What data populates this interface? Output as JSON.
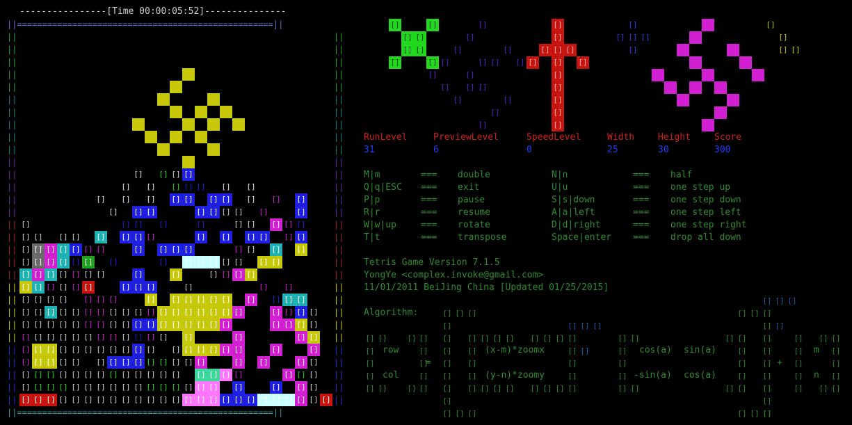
{
  "timer": {
    "text": "----------------[Time 00:00:05:52]---------------"
  },
  "board": {
    "width": 25,
    "height": 30
  },
  "stats": {
    "labels": [
      "RunLevel",
      "PreviewLevel",
      "SpeedLevel",
      "Width",
      "Height",
      "Score"
    ],
    "values": [
      "31",
      "6",
      "0",
      "25",
      "30",
      "300"
    ],
    "label_color": "#d0201a",
    "value_color": "#1e3cff"
  },
  "keys": [
    {
      "key": "M|m",
      "sep": "===",
      "action": "double",
      "key2": "N|n",
      "sep2": "===",
      "action2": "half"
    },
    {
      "key": "Q|q|ESC",
      "sep": "===",
      "action": "exit",
      "key2": "U|u",
      "sep2": "===",
      "action2": "one step up"
    },
    {
      "key": "P|p",
      "sep": "===",
      "action": "pause",
      "key2": "S|s|down",
      "sep2": "===",
      "action2": "one step down"
    },
    {
      "key": "R|r",
      "sep": "===",
      "action": "resume",
      "key2": "A|a|left",
      "sep2": "===",
      "action2": "one step left"
    },
    {
      "key": "W|w|up",
      "sep": "===",
      "action": "rotate",
      "key2": "D|d|right",
      "sep2": "===",
      "action2": "one step right"
    },
    {
      "key": "T|t",
      "sep": "===",
      "action": "transpose",
      "key2": "Space|enter",
      "sep2": "===",
      "action2": "drop all down"
    }
  ],
  "info": {
    "line1": "Tetris Game  Version 7.1.5",
    "line2": "YongYe <complex.invoke@gmail.com>",
    "line3": "11/01/2011 BeiJing China [Updated 01/25/2015]"
  },
  "algorithm": {
    "label": "Algorithm:",
    "row": "row",
    "col": "col",
    "eq": "=",
    "x_expr": "(x-m)*zoomx",
    "y_expr": "(y-n)*zoomy",
    "cos1": "cos(a)",
    "sin1": "sin(a)",
    "msin": "-sin(a)",
    "cos2": "cos(a)",
    "plus": "+",
    "m": "m",
    "n": "n"
  },
  "glyphs": {
    "block": "[]"
  },
  "colors": {
    "green": "#22d81e",
    "red": "#c8140f",
    "magenta": "#d21fd2",
    "yellow": "#c8c80a",
    "blue": "#1f1fe0",
    "cyan": "#20b2b2",
    "white": "#e8e8e8",
    "purple": "#5a1fd2"
  }
}
